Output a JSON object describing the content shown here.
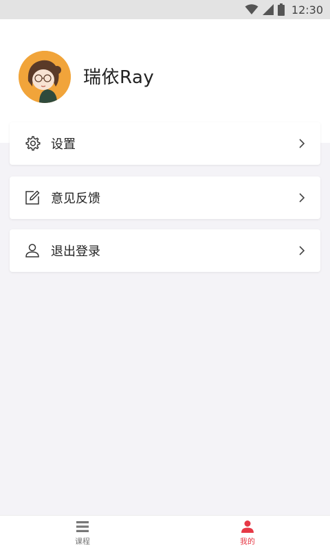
{
  "status_bar": {
    "time": "12:30",
    "icons": [
      "wifi-icon",
      "cellular-signal-icon",
      "battery-icon"
    ]
  },
  "profile": {
    "name": "瑞依Ray",
    "avatar_icon": "avatar-icon"
  },
  "menu": [
    {
      "label": "设置",
      "icon": "gear-icon"
    },
    {
      "label": "意见反馈",
      "icon": "edit-note-icon"
    },
    {
      "label": "退出登录",
      "icon": "user-icon"
    }
  ],
  "tabbar": {
    "tabs": [
      {
        "label": "课程",
        "icon": "list-icon",
        "active": false
      },
      {
        "label": "我的",
        "icon": "person-icon",
        "active": true
      }
    ],
    "active_color": "#e63946",
    "inactive_color": "#777777"
  }
}
